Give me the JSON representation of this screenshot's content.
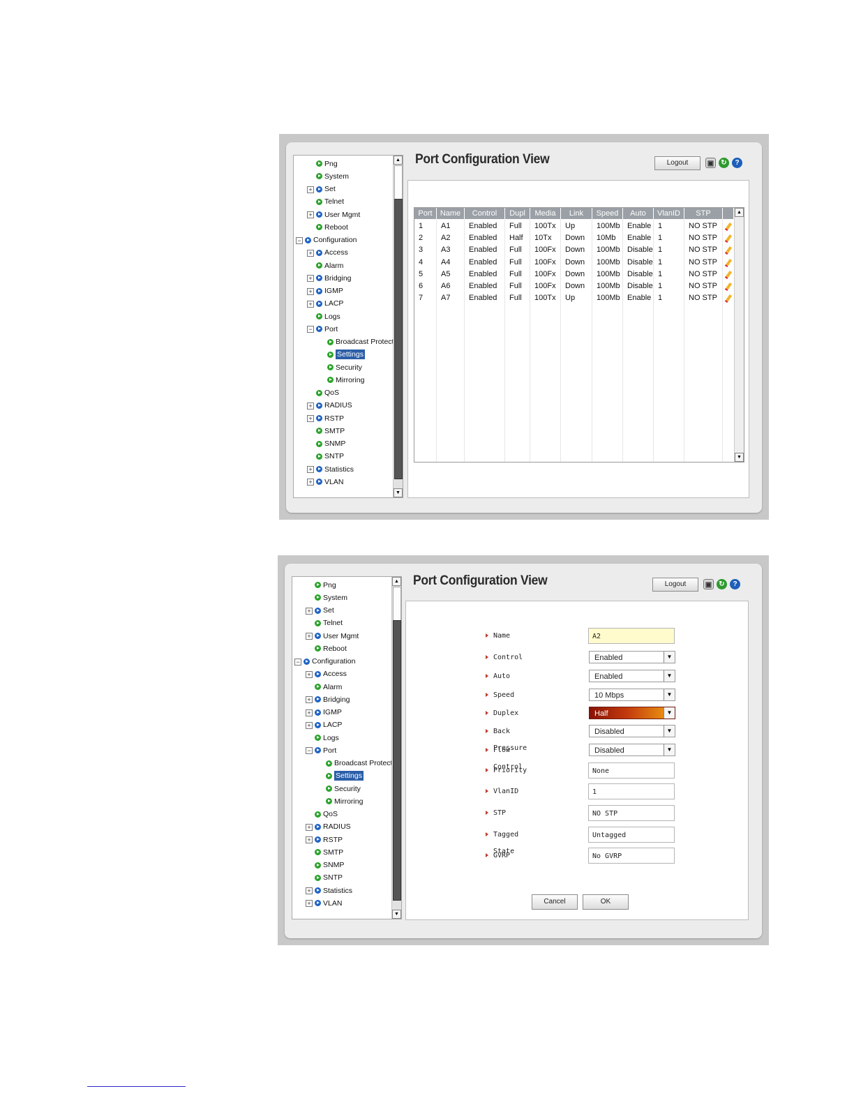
{
  "view_title": "Port Configuration View",
  "logout_label": "Logout",
  "toolbar_icons": [
    "save-icon",
    "refresh-icon",
    "help-icon"
  ],
  "tree": [
    {
      "label": "Png",
      "icon": "green",
      "level": 1,
      "expander": ""
    },
    {
      "label": "System",
      "icon": "green",
      "level": 1,
      "expander": ""
    },
    {
      "label": "Set",
      "icon": "blue",
      "level": 1,
      "expander": "+"
    },
    {
      "label": "Telnet",
      "icon": "green",
      "level": 1,
      "expander": ""
    },
    {
      "label": "User Mgmt",
      "icon": "blue",
      "level": 1,
      "expander": "+"
    },
    {
      "label": "Reboot",
      "icon": "green",
      "level": 1,
      "expander": ""
    },
    {
      "label": "Configuration",
      "icon": "blue",
      "level": 0,
      "expander": "−"
    },
    {
      "label": "Access",
      "icon": "blue",
      "level": 1,
      "expander": "+"
    },
    {
      "label": "Alarm",
      "icon": "green",
      "level": 1,
      "expander": ""
    },
    {
      "label": "Bridging",
      "icon": "blue",
      "level": 1,
      "expander": "+"
    },
    {
      "label": "IGMP",
      "icon": "blue",
      "level": 1,
      "expander": "+"
    },
    {
      "label": "LACP",
      "icon": "blue",
      "level": 1,
      "expander": "+"
    },
    {
      "label": "Logs",
      "icon": "green",
      "level": 1,
      "expander": ""
    },
    {
      "label": "Port",
      "icon": "blue",
      "level": 1,
      "expander": "−"
    },
    {
      "label": "Broadcast Protect",
      "icon": "green",
      "level": 2,
      "expander": ""
    },
    {
      "label": "Settings",
      "icon": "green",
      "level": 2,
      "expander": "",
      "selected": true
    },
    {
      "label": "Security",
      "icon": "green",
      "level": 2,
      "expander": ""
    },
    {
      "label": "Mirroring",
      "icon": "green",
      "level": 2,
      "expander": ""
    },
    {
      "label": "QoS",
      "icon": "green",
      "level": 1,
      "expander": ""
    },
    {
      "label": "RADIUS",
      "icon": "blue",
      "level": 1,
      "expander": "+"
    },
    {
      "label": "RSTP",
      "icon": "blue",
      "level": 1,
      "expander": "+"
    },
    {
      "label": "SMTP",
      "icon": "green",
      "level": 1,
      "expander": ""
    },
    {
      "label": "SNMP",
      "icon": "green",
      "level": 1,
      "expander": ""
    },
    {
      "label": "SNTP",
      "icon": "green",
      "level": 1,
      "expander": ""
    },
    {
      "label": "Statistics",
      "icon": "blue",
      "level": 1,
      "expander": "+"
    },
    {
      "label": "VLAN",
      "icon": "blue",
      "level": 1,
      "expander": "+"
    }
  ],
  "table": {
    "headers": [
      "Port",
      "Name",
      "Control",
      "Dupl",
      "Media",
      "Link",
      "Speed",
      "Auto",
      "VlanID",
      "STP"
    ],
    "rows": [
      [
        "1",
        "A1",
        "Enabled",
        "Full",
        "100Tx",
        "Up",
        "100Mb",
        "Enable",
        "1",
        "NO STP"
      ],
      [
        "2",
        "A2",
        "Enabled",
        "Half",
        "10Tx",
        "Down",
        "10Mb",
        "Enable",
        "1",
        "NO STP"
      ],
      [
        "3",
        "A3",
        "Enabled",
        "Full",
        "100Fx",
        "Down",
        "100Mb",
        "Disable",
        "1",
        "NO STP"
      ],
      [
        "4",
        "A4",
        "Enabled",
        "Full",
        "100Fx",
        "Down",
        "100Mb",
        "Disable",
        "1",
        "NO STP"
      ],
      [
        "5",
        "A5",
        "Enabled",
        "Full",
        "100Fx",
        "Down",
        "100Mb",
        "Disable",
        "1",
        "NO STP"
      ],
      [
        "6",
        "A6",
        "Enabled",
        "Full",
        "100Fx",
        "Down",
        "100Mb",
        "Disable",
        "1",
        "NO STP"
      ],
      [
        "7",
        "A7",
        "Enabled",
        "Full",
        "100Tx",
        "Up",
        "100Mb",
        "Enable",
        "1",
        "NO STP"
      ]
    ]
  },
  "form": {
    "name": {
      "label": "Name",
      "value": "A2"
    },
    "control": {
      "label": "Control",
      "value": "Enabled"
    },
    "auto": {
      "label": "Auto",
      "value": "Enabled"
    },
    "speed": {
      "label": "Speed",
      "value": "10 Mbps"
    },
    "duplex": {
      "label": "Duplex",
      "value": "Half"
    },
    "back_pressure": {
      "label": "Back Pressure",
      "value": "Disabled"
    },
    "flow_control": {
      "label": "Flow Control",
      "value": "Disabled"
    },
    "priority": {
      "label": "Priority",
      "value": "None"
    },
    "vlanid": {
      "label": "VlanID",
      "value": "1"
    },
    "stp": {
      "label": "STP",
      "value": "NO STP"
    },
    "tagged_state": {
      "label": "Tagged State",
      "value": "Untagged"
    },
    "gvrp": {
      "label": "GVRP",
      "value": "No GVRP"
    },
    "cancel_label": "Cancel",
    "ok_label": "OK"
  },
  "colors": {
    "selection": "#2b5ea8",
    "table_header": "#9aa0a6",
    "duplex_gradient_start": "#8a1206",
    "duplex_gradient_end": "#f1a414",
    "name_field_bg": "#fffbcc"
  }
}
